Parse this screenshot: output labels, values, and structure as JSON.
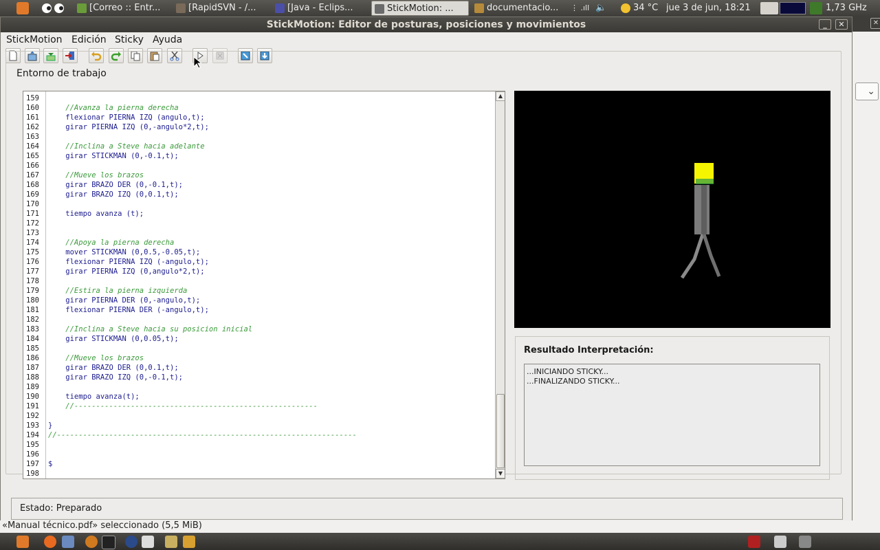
{
  "top_panel": {
    "tasks": [
      {
        "label": "[Correo :: Entr...",
        "active": false,
        "color": "#6a9c3a"
      },
      {
        "label": "[RapidSVN - /...",
        "active": false,
        "color": "#7a6a5a"
      },
      {
        "label": "[Java - Eclips...",
        "active": false,
        "color": "#4b4fa8"
      },
      {
        "label": "StickMotion: ...",
        "active": true,
        "color": "#6b6b6b"
      },
      {
        "label": "documentacio...",
        "active": false,
        "color": "#b58a3a"
      }
    ],
    "weather": "34 °C",
    "clock": "jue  3 de jun, 18:21",
    "cpu_freq": "1,73 GHz"
  },
  "window": {
    "title": "StickMotion: Editor de posturas, posiciones y movimientos",
    "minimize_label": "_",
    "close_label": "✕"
  },
  "menu": [
    "StickMotion",
    "Edición",
    "Sticky",
    "Ayuda"
  ],
  "toolbar": {
    "buttons": [
      "new-file-icon",
      "open-file-icon",
      "save-file-icon",
      "exit-icon",
      "undo-icon",
      "redo-icon",
      "copy-icon",
      "paste-icon",
      "cut-icon",
      "play-icon",
      "stop-icon",
      "import-icon",
      "export-icon"
    ]
  },
  "workspace": {
    "label": "Entorno de trabajo"
  },
  "editor": {
    "lines": [
      {
        "n": "159",
        "t": ""
      },
      {
        "n": "160",
        "t": "    //Avanza la pierna derecha",
        "c": true
      },
      {
        "n": "161",
        "t": "    flexionar PIERNA IZQ (angulo,t);"
      },
      {
        "n": "162",
        "t": "    girar PIERNA IZQ (0,-angulo*2,t);"
      },
      {
        "n": "163",
        "t": ""
      },
      {
        "n": "164",
        "t": "    //Inclina a Steve hacia adelante",
        "c": true
      },
      {
        "n": "165",
        "t": "    girar STICKMAN (0,-0.1,t);"
      },
      {
        "n": "166",
        "t": ""
      },
      {
        "n": "167",
        "t": "    //Mueve los brazos",
        "c": true
      },
      {
        "n": "168",
        "t": "    girar BRAZO DER (0,-0.1,t);"
      },
      {
        "n": "169",
        "t": "    girar BRAZO IZQ (0,0.1,t);"
      },
      {
        "n": "170",
        "t": ""
      },
      {
        "n": "171",
        "t": "    tiempo avanza (t);"
      },
      {
        "n": "172",
        "t": ""
      },
      {
        "n": "173",
        "t": ""
      },
      {
        "n": "174",
        "t": "    //Apoya la pierna derecha",
        "c": true
      },
      {
        "n": "175",
        "t": "    mover STICKMAN (0,0.5,-0.05,t);"
      },
      {
        "n": "176",
        "t": "    flexionar PIERNA IZQ (-angulo,t);"
      },
      {
        "n": "177",
        "t": "    girar PIERNA IZQ (0,angulo*2,t);"
      },
      {
        "n": "178",
        "t": ""
      },
      {
        "n": "179",
        "t": "    //Estira la pierna izquierda",
        "c": true
      },
      {
        "n": "180",
        "t": "    girar PIERNA DER (0,-angulo,t);"
      },
      {
        "n": "181",
        "t": "    flexionar PIERNA DER (-angulo,t);"
      },
      {
        "n": "182",
        "t": ""
      },
      {
        "n": "183",
        "t": "    //Inclina a Steve hacia su posicion inicial",
        "c": true
      },
      {
        "n": "184",
        "t": "    girar STICKMAN (0,0.05,t);"
      },
      {
        "n": "185",
        "t": ""
      },
      {
        "n": "186",
        "t": "    //Mueve los brazos",
        "c": true
      },
      {
        "n": "187",
        "t": "    girar BRAZO DER (0,0.1,t);"
      },
      {
        "n": "188",
        "t": "    girar BRAZO IZQ (0,-0.1,t);"
      },
      {
        "n": "189",
        "t": ""
      },
      {
        "n": "190",
        "t": "    tiempo avanza(t);"
      },
      {
        "n": "191",
        "t": "    //--------------------------------------------------------",
        "c": true
      },
      {
        "n": "192",
        "t": ""
      },
      {
        "n": "193",
        "t": "}"
      },
      {
        "n": "194",
        "t": "//---------------------------------------------------------------------",
        "c": true
      },
      {
        "n": "195",
        "t": ""
      },
      {
        "n": "196",
        "t": ""
      },
      {
        "n": "197",
        "t": "$"
      },
      {
        "n": "198",
        "t": ""
      }
    ]
  },
  "result": {
    "title": "Resultado Interpretación:",
    "lines": [
      "...INICIANDO STICKY...",
      "...FINALIZANDO STICKY..."
    ]
  },
  "status": {
    "label": "Estado:",
    "value": "Preparado"
  },
  "file_manager_status": "«Manual técnico.pdf» seleccionado (5,5 MiB)"
}
